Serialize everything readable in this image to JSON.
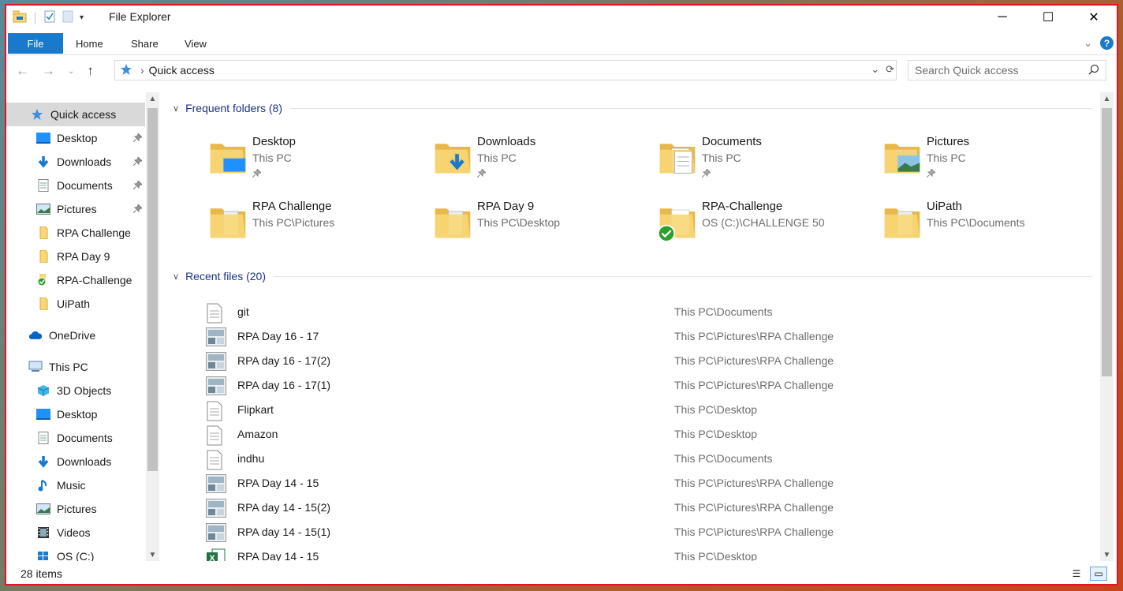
{
  "window": {
    "title": "File Explorer",
    "controls": {
      "minimize": "─",
      "maximize": "☐",
      "close": "✕"
    }
  },
  "ribbon": {
    "file": "File",
    "tabs": [
      "Home",
      "Share",
      "View"
    ]
  },
  "address": {
    "crumb": "Quick access",
    "separator": "›"
  },
  "search": {
    "placeholder": "Search Quick access"
  },
  "nav": {
    "items": [
      {
        "label": "Quick access",
        "icon": "star-icon",
        "pinned": false
      },
      {
        "label": "Desktop",
        "icon": "desktop-icon",
        "pinned": true
      },
      {
        "label": "Downloads",
        "icon": "download-icon",
        "pinned": true
      },
      {
        "label": "Documents",
        "icon": "documents-icon",
        "pinned": true
      },
      {
        "label": "Pictures",
        "icon": "pictures-icon",
        "pinned": true
      },
      {
        "label": "RPA Challenge",
        "icon": "folder-icon",
        "pinned": false
      },
      {
        "label": "RPA Day 9",
        "icon": "folder-icon",
        "pinned": false
      },
      {
        "label": "RPA-Challenge",
        "icon": "synced-folder-icon",
        "pinned": false
      },
      {
        "label": "UiPath",
        "icon": "folder-icon",
        "pinned": false
      },
      {
        "label": "OneDrive",
        "icon": "cloud-icon",
        "pinned": false
      },
      {
        "label": "This PC",
        "icon": "computer-icon",
        "pinned": false
      },
      {
        "label": "3D Objects",
        "icon": "cube-icon",
        "pinned": false
      },
      {
        "label": "Desktop",
        "icon": "desktop-icon",
        "pinned": false
      },
      {
        "label": "Documents",
        "icon": "documents-icon",
        "pinned": false
      },
      {
        "label": "Downloads",
        "icon": "download-icon",
        "pinned": false
      },
      {
        "label": "Music",
        "icon": "music-icon",
        "pinned": false
      },
      {
        "label": "Pictures",
        "icon": "pictures-icon",
        "pinned": false
      },
      {
        "label": "Videos",
        "icon": "video-icon",
        "pinned": false
      },
      {
        "label": "OS (C:)",
        "icon": "drive-icon",
        "pinned": false
      }
    ]
  },
  "frequent": {
    "header": "Frequent folders (8)",
    "folders": [
      {
        "name": "Desktop",
        "path": "This PC",
        "pinned": true,
        "icon": "desktop-folder-icon"
      },
      {
        "name": "Downloads",
        "path": "This PC",
        "pinned": true,
        "icon": "downloads-folder-icon"
      },
      {
        "name": "Documents",
        "path": "This PC",
        "pinned": true,
        "icon": "documents-folder-icon"
      },
      {
        "name": "Pictures",
        "path": "This PC",
        "pinned": true,
        "icon": "pictures-folder-icon"
      },
      {
        "name": "RPA Challenge",
        "path": "This PC\\Pictures",
        "pinned": false,
        "icon": "folder-icon"
      },
      {
        "name": "RPA Day 9",
        "path": "This PC\\Desktop",
        "pinned": false,
        "icon": "folder-icon"
      },
      {
        "name": "RPA-Challenge",
        "path": "OS (C:)\\CHALLENGE 50",
        "pinned": false,
        "icon": "synced-folder-icon"
      },
      {
        "name": "UiPath",
        "path": "This PC\\Documents",
        "pinned": false,
        "icon": "folder-icon"
      }
    ]
  },
  "recent": {
    "header": "Recent files (20)",
    "files": [
      {
        "name": "git",
        "path": "This PC\\Documents",
        "icon": "text-file-icon"
      },
      {
        "name": "RPA Day 16 - 17",
        "path": "This PC\\Pictures\\RPA Challenge",
        "icon": "image-file-icon"
      },
      {
        "name": "RPA day 16 - 17(2)",
        "path": "This PC\\Pictures\\RPA Challenge",
        "icon": "image-file-icon"
      },
      {
        "name": "RPA day 16 - 17(1)",
        "path": "This PC\\Pictures\\RPA Challenge",
        "icon": "image-file-icon"
      },
      {
        "name": "Flipkart",
        "path": "This PC\\Desktop",
        "icon": "text-file-icon"
      },
      {
        "name": "Amazon",
        "path": "This PC\\Desktop",
        "icon": "text-file-icon"
      },
      {
        "name": "indhu",
        "path": "This PC\\Documents",
        "icon": "text-file-icon"
      },
      {
        "name": "RPA Day 14 - 15",
        "path": "This PC\\Pictures\\RPA Challenge",
        "icon": "image-file-icon"
      },
      {
        "name": "RPA day 14 - 15(2)",
        "path": "This PC\\Pictures\\RPA Challenge",
        "icon": "image-file-icon"
      },
      {
        "name": "RPA day 14 - 15(1)",
        "path": "This PC\\Pictures\\RPA Challenge",
        "icon": "image-file-icon"
      },
      {
        "name": "RPA Day 14 - 15",
        "path": "This PC\\Desktop",
        "icon": "excel-file-icon"
      }
    ]
  },
  "status": {
    "items": "28 items"
  },
  "colors": {
    "accent": "#1979ca",
    "selection": "#d9d9d9",
    "folder": "#f8d775",
    "link": "#1e3287",
    "frame": "#e81123"
  }
}
